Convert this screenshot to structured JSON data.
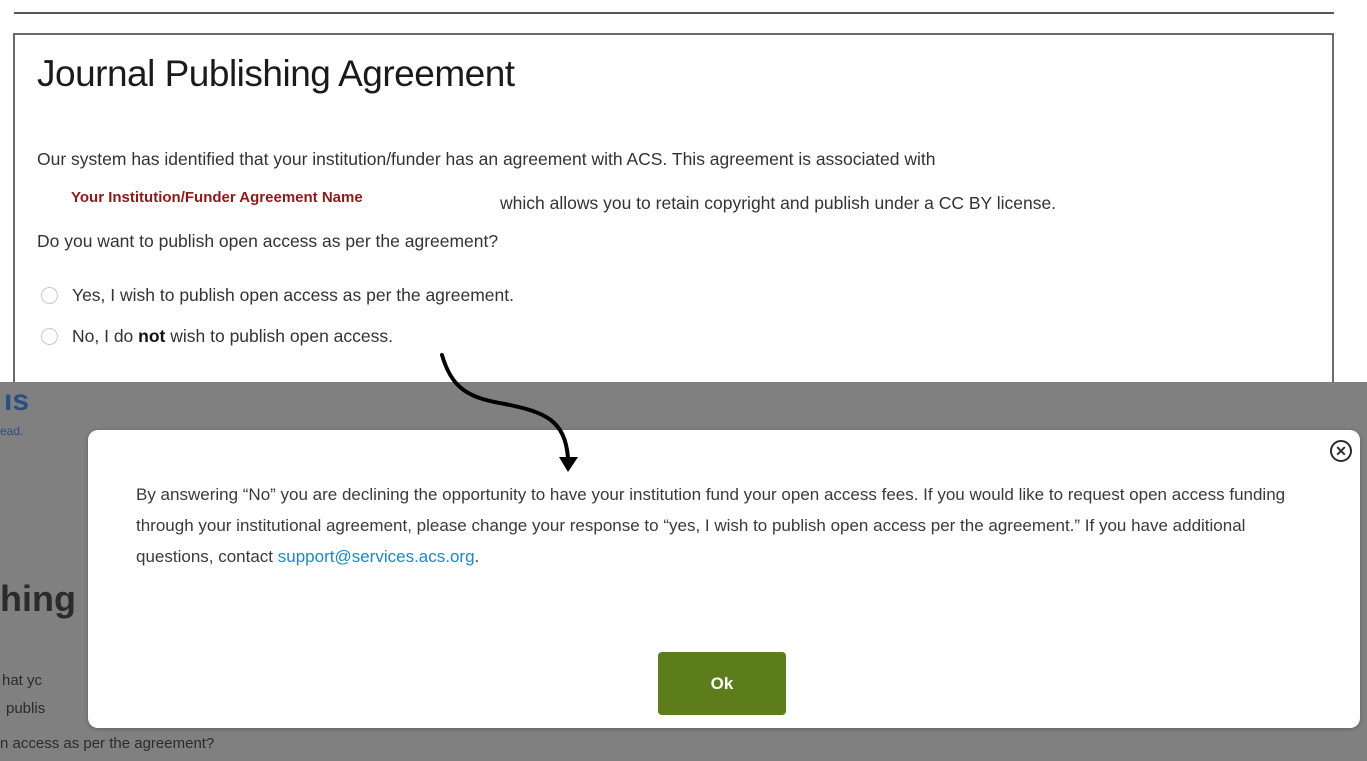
{
  "agreement": {
    "title": "Journal Publishing Agreement",
    "line1": "Our system has identified that your institution/funder has an agreement with ACS. This agreement is associated with",
    "agreement_name": "Your Institution/Funder Agreement Name",
    "line2": "which allows you to retain copyright and publish under a CC BY license.",
    "question": "Do you want to publish open access as per the agreement?",
    "option_yes": "Yes, I wish to publish open access as per the agreement.",
    "option_no_prefix": "No, I do ",
    "option_no_bold": "not",
    "option_no_suffix": " wish to publish open access."
  },
  "background_fragment": {
    "logo_text": "ıs",
    "logo_sub": "ead.",
    "heading": "hing",
    "text_1": "hat yc",
    "text_2": "publis",
    "text_3": "n access as per the agreement?"
  },
  "modal": {
    "message_before_link": "By answering “No” you are declining the opportunity to have your institution fund your open access fees. If you would like to request open access funding through your institutional agreement, please change your response to “yes, I wish to publish open access per the agreement.” If you have additional questions, contact ",
    "support_email": "support@services.acs.org",
    "message_after_link": ".",
    "close_symbol": "✕",
    "ok_label": "Ok"
  },
  "colors": {
    "agreement_name": "#8b1a1a",
    "link": "#1e87c9",
    "ok_button": "#5d7d1c",
    "overlay": "#808080"
  }
}
